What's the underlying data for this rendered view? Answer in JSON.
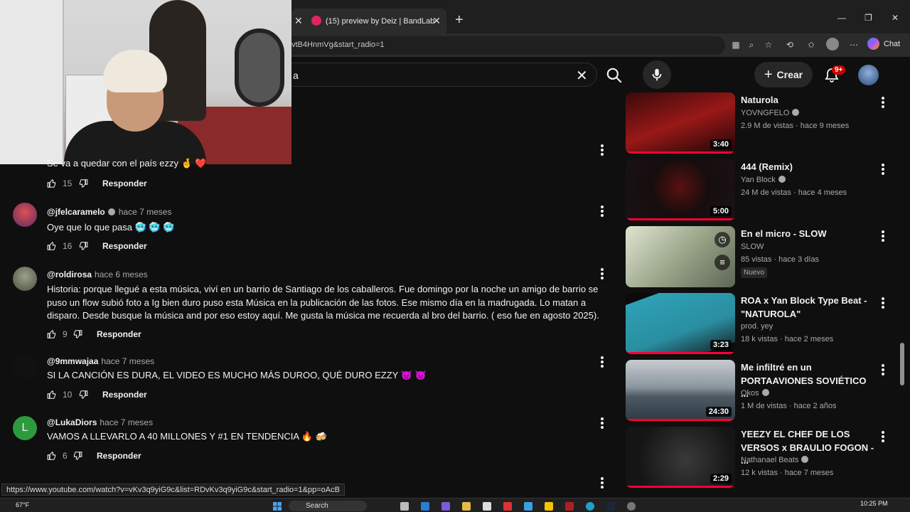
{
  "browser": {
    "tab_title": "(15) preview by Deiz | BandLab",
    "address": "vtB4HnmVg&start_radio=1",
    "chat_label": "Chat"
  },
  "youtube": {
    "search_value": "a",
    "create_label": "Crear",
    "notif_count": "9+"
  },
  "comments": [
    {
      "text": "Se va a quedar con el país ezzy 🤞 ❤️",
      "likes": "15",
      "reply": "Responder"
    },
    {
      "user": "@jfelcaramelo",
      "time": "hace 7 meses",
      "text": "Oye que lo que pasa 🥶 🥶 🥶",
      "likes": "16",
      "reply": "Responder"
    },
    {
      "user": "@roldirosa",
      "time": "hace 6 meses",
      "text": "Historia: porque llegué a esta música, viví en un barrio de Santiago de los caballeros. Fue domingo por la noche un amigo de barrio se puso un flow subió foto a Ig bien duro puso esta Música en la publicación de las fotos. Ese mismo día en la madrugada. Lo matan a disparo. Desde busque la música and por eso estoy aquí. Me gusta la música me recuerda al bro del barrio. ( eso fue en agosto 2025).",
      "likes": "9",
      "reply": "Responder"
    },
    {
      "user": "@9mmwajaa",
      "time": "hace 7 meses",
      "text": "SI LA CANCIÓN ES DURA, EL VIDEO ES MUCHO MÁS DUROO, QUÉ DURO EZZY 😈 😈",
      "likes": "10",
      "reply": "Responder"
    },
    {
      "user": "@LukaDiors",
      "time": "hace 7 meses",
      "avatar_letter": "L",
      "text": "VAMOS A LLEVARLO A 40 MILLONES Y #1 EN TENDENCIA 🔥 🍻",
      "likes": "6",
      "reply": "Responder"
    }
  ],
  "status_url": "https://www.youtube.com/watch?v=vKv3q9yiG9c&list=RDvKv3q9yiG9c&start_radio=1&pp=oAcB",
  "sidebar": [
    {
      "title": "Naturola",
      "channel": "YOVNGFELO",
      "verified": true,
      "meta": "2.9 M de vistas · hace 9 meses",
      "duration": "3:40",
      "thumb_color": "#7a1010"
    },
    {
      "title": "444 (Remix)",
      "channel": "Yan Block",
      "verified": true,
      "meta": "24 M de vistas · hace 4 meses",
      "duration": "5:00",
      "thumb_color": "#1a1214"
    },
    {
      "title": "En el micro - SLOW",
      "channel": "SLOW",
      "verified": false,
      "meta": "85 vistas · hace 3 días",
      "badge": "Nuevo",
      "thumb_color": "#9aa58a"
    },
    {
      "title": "ROA x Yan Block Type Beat - \"NATUROLA\"",
      "channel": "prod. yey",
      "verified": false,
      "meta": "18 k vistas · hace 2 meses",
      "duration": "3:23",
      "thumb_color": "#2a8ea0"
    },
    {
      "title": "Me infiltré en un PORTAAVIONES SOVIÉTICO ...",
      "channel": "Okos",
      "verified": true,
      "meta": "1 M de vistas · hace 2 años",
      "duration": "24:30",
      "thumb_color": "#6b7a85"
    },
    {
      "title": "YEEZY EL CHEF DE LOS VERSOS x BRAULIO FOGON  - ...",
      "channel": "Nathanael Beats",
      "verified": true,
      "meta": "12 k vistas · hace 7 meses",
      "duration": "2:29",
      "thumb_color": "#2b2b2b"
    }
  ],
  "taskbar": {
    "weather": "67°F",
    "search_label": "Search",
    "time": "10:25 PM"
  },
  "colors": {
    "accent": "#ff0033",
    "notif": "#cc0000"
  }
}
